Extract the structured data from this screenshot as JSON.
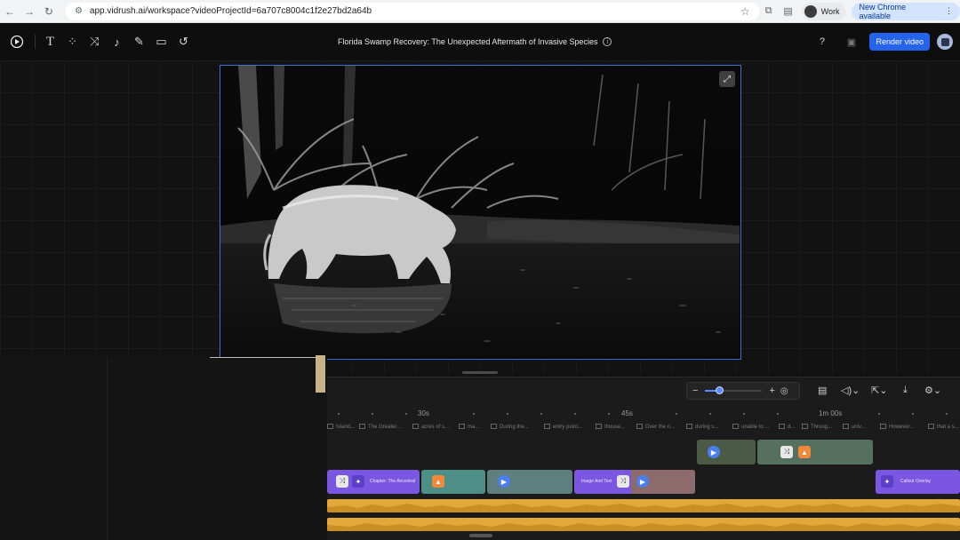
{
  "browser": {
    "url": "app.vidrush.ai/workspace?videoProjectId=6a707c8004c1f2e27bd2a64b",
    "profile_label": "Work",
    "update_label": "New Chrome available"
  },
  "app": {
    "title": "Florida Swamp Recovery: The Unexpected Aftermath of Invasive Species",
    "render_label": "Render video",
    "toolbar_icons": [
      "logo-icon",
      "text-icon",
      "elements-icon",
      "transition-icon",
      "music-icon",
      "magic-icon",
      "folder-icon",
      "history-icon"
    ]
  },
  "timeline": {
    "ruler_labels": [
      "30s",
      "45s",
      "1m 00s"
    ],
    "captions": [
      "Island...",
      "The Greater...",
      "acres of s...",
      "ma...",
      "During the...",
      "entry point...",
      "thouse...",
      "Over the n...",
      "during s...",
      "unable to ...",
      "d...",
      "Throug...",
      "univ...",
      "However...",
      "that a s..."
    ],
    "clips": {
      "chapter_label": "Chapter: The Ancestral",
      "image_text_label": "Image And Text",
      "callout_label": "Callout Overlay"
    }
  },
  "colors": {
    "accent": "#2563eb",
    "clip_purple": "#7b56e0",
    "audio": "#e3a83a",
    "selection": "#3d6fd8"
  }
}
